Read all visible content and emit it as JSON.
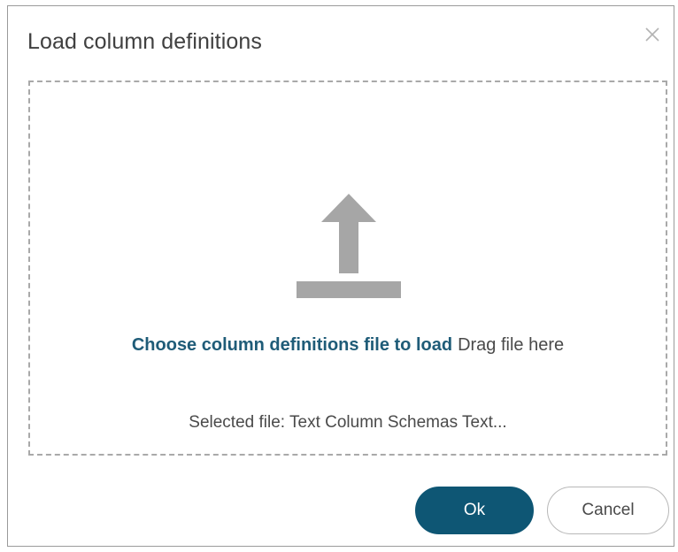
{
  "dialog": {
    "title": "Load column definitions",
    "close_icon": "close-icon"
  },
  "dropzone": {
    "upload_icon": "upload-icon",
    "choose_label": "Choose column definitions file to load",
    "drag_label": "Drag file here",
    "selected_file": "Selected file: Text Column Schemas Text..."
  },
  "footer": {
    "ok_label": "Ok",
    "cancel_label": "Cancel"
  },
  "colors": {
    "accent": "#0e5674",
    "link": "#1f5c78",
    "icon_gray": "#a6a6a6",
    "border_gray": "#a9a9a9"
  }
}
